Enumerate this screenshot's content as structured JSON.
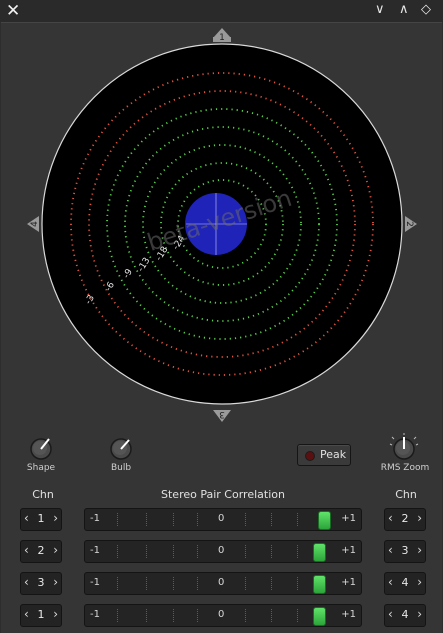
{
  "window": {
    "close_glyph": "✕",
    "minimize_glyph": "∨",
    "maximize_glyph": "∧",
    "restore_glyph": "◇"
  },
  "scope": {
    "markers": {
      "top": "1",
      "right": "2",
      "bottom": "3",
      "left": "4"
    },
    "ring_labels": [
      "-3",
      "-6",
      "-9",
      "-13",
      "-18",
      "-24"
    ],
    "watermark": "beta-version"
  },
  "controls": {
    "shape_label": "Shape",
    "bulb_label": "Bulb",
    "peak_label": "Peak",
    "rms_zoom_label": "RMS Zoom"
  },
  "correlation": {
    "chn_left_header": "Chn",
    "title": "Stereo Pair Correlation",
    "chn_right_header": "Chn",
    "scale": {
      "min": "-1",
      "mid": "0",
      "max": "+1"
    },
    "rows": [
      {
        "left": "1",
        "right": "2",
        "value": 0.86
      },
      {
        "left": "2",
        "right": "3",
        "value": 0.81
      },
      {
        "left": "3",
        "right": "4",
        "value": 0.81
      },
      {
        "left": "1",
        "right": "4",
        "value": 0.81
      }
    ]
  },
  "colors": {
    "scope_blob": "#1f23b8",
    "ring_red": "#e2543f",
    "ring_green": "#56d04a",
    "correlation_thumb": "#3cc447"
  }
}
